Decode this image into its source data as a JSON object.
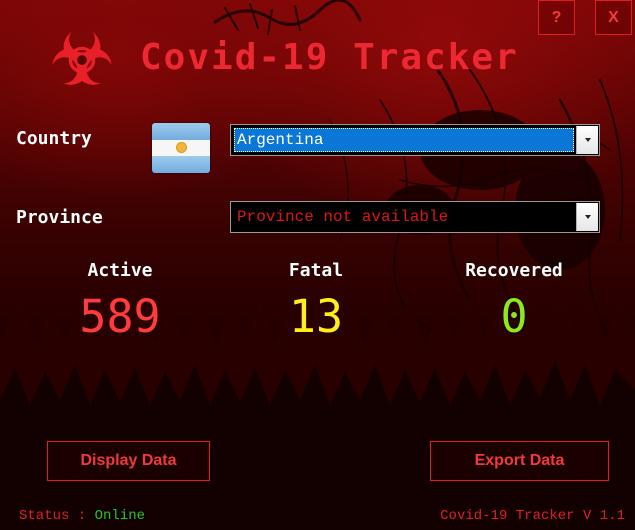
{
  "app": {
    "title": "Covid-19 Tracker"
  },
  "titlebar": {
    "help_label": "?",
    "close_label": "X"
  },
  "form": {
    "country_label": "Country",
    "country_value": "Argentina",
    "province_label": "Province",
    "province_value": "Province not available"
  },
  "stats": {
    "active_label": "Active",
    "active_value": "589",
    "fatal_label": "Fatal",
    "fatal_value": "13",
    "recovered_label": "Recovered",
    "recovered_value": "0"
  },
  "actions": {
    "display_label": "Display Data",
    "export_label": "Export Data"
  },
  "footer": {
    "status_key": "Status : ",
    "status_value": "Online",
    "version": "Covid-19 Tracker V 1.1"
  },
  "icons": {
    "logo": "biohazard-icon",
    "flag": "argentina-flag-icon",
    "dropdown": "chevron-down-icon"
  },
  "colors": {
    "accent": "#ee2833",
    "active": "#ff3b3b",
    "fatal": "#ffee1a",
    "recovered": "#8bea1e",
    "online": "#22c622",
    "selection": "#0a77d6"
  }
}
